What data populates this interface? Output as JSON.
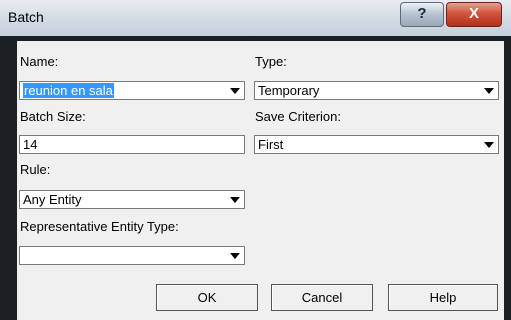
{
  "window": {
    "title": "Batch",
    "help_glyph": "?",
    "close_glyph": "X"
  },
  "form": {
    "name": {
      "label": "Name:",
      "value": "reunion en sala"
    },
    "type": {
      "label": "Type:",
      "value": "Temporary"
    },
    "batch_size": {
      "label": "Batch Size:",
      "value": "14"
    },
    "save_criterion": {
      "label": "Save Criterion:",
      "value": "First"
    },
    "rule": {
      "label": "Rule:",
      "value": "Any Entity"
    },
    "rep_type": {
      "label": "Representative Entity Type:",
      "value": ""
    }
  },
  "buttons": {
    "ok": "OK",
    "cancel": "Cancel",
    "help": "Help"
  },
  "icons": {
    "dropdown": "chevron-down-icon"
  }
}
